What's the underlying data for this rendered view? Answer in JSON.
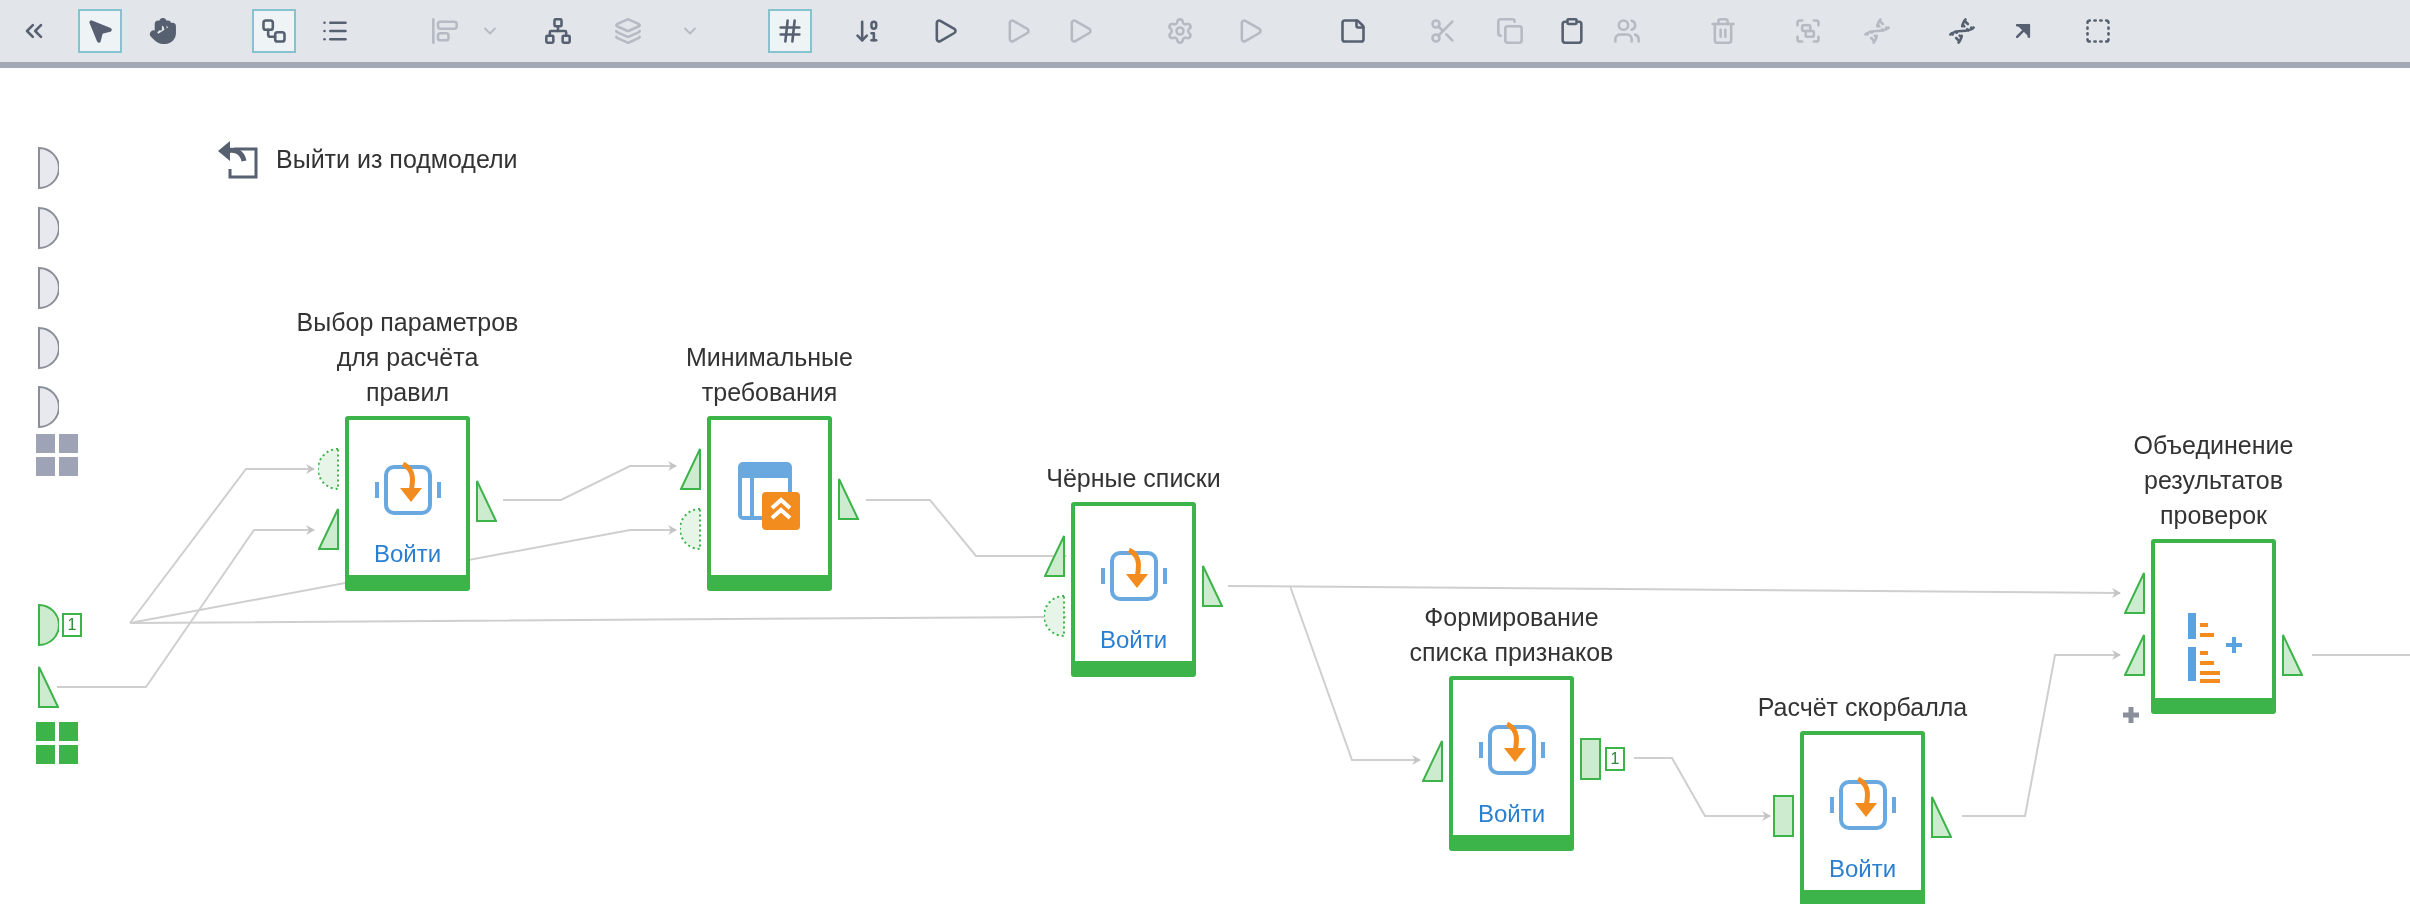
{
  "toolbar": {
    "tools": [
      {
        "kind": "collapse",
        "selected": false,
        "disabled": false
      },
      {
        "kind": "pointer",
        "selected": true,
        "disabled": false
      },
      {
        "kind": "hand",
        "selected": false,
        "disabled": false
      },
      {
        "kind": "diagram",
        "selected": true,
        "disabled": false
      },
      {
        "kind": "list",
        "selected": false,
        "disabled": false
      },
      {
        "kind": "align",
        "selected": false,
        "disabled": true
      },
      {
        "kind": "caret",
        "selected": false,
        "disabled": true
      },
      {
        "kind": "network",
        "selected": false,
        "disabled": false
      },
      {
        "kind": "layers",
        "selected": false,
        "disabled": true
      },
      {
        "kind": "caret",
        "selected": false,
        "disabled": true
      },
      {
        "kind": "hash",
        "selected": true,
        "disabled": false
      },
      {
        "kind": "numbers",
        "selected": false,
        "disabled": false
      },
      {
        "kind": "play",
        "selected": false,
        "disabled": false
      },
      {
        "kind": "play",
        "selected": false,
        "disabled": true
      },
      {
        "kind": "play",
        "selected": false,
        "disabled": true
      },
      {
        "kind": "gear",
        "selected": false,
        "disabled": true
      },
      {
        "kind": "play",
        "selected": false,
        "disabled": true
      },
      {
        "kind": "note",
        "selected": false,
        "disabled": false
      },
      {
        "kind": "cut",
        "selected": false,
        "disabled": true
      },
      {
        "kind": "copy",
        "selected": false,
        "disabled": true
      },
      {
        "kind": "paste",
        "selected": false,
        "disabled": false
      },
      {
        "kind": "people",
        "selected": false,
        "disabled": true
      },
      {
        "kind": "trash",
        "selected": false,
        "disabled": true
      },
      {
        "kind": "group",
        "selected": false,
        "disabled": true
      },
      {
        "kind": "dna",
        "selected": false,
        "disabled": true
      },
      {
        "kind": "dna",
        "selected": false,
        "disabled": false
      },
      {
        "kind": "arrow",
        "selected": false,
        "disabled": false
      },
      {
        "kind": "selection",
        "selected": false,
        "disabled": false
      }
    ]
  },
  "exit_link": {
    "label": "Выйти из подмодели"
  },
  "model_ports": [
    {
      "kind": "half",
      "active": false
    },
    {
      "kind": "half",
      "active": false
    },
    {
      "kind": "half",
      "active": false
    },
    {
      "kind": "half",
      "active": false
    },
    {
      "kind": "half",
      "active": false
    },
    {
      "kind": "grid",
      "active": false
    },
    {
      "kind": "half",
      "active": true,
      "badge": "1"
    },
    {
      "kind": "triangle",
      "active": true
    },
    {
      "kind": "grid",
      "active": true
    }
  ],
  "nodes": [
    {
      "kind": "enter",
      "label": "Выбор параметров\nдля расчёта\nправил",
      "action": "Войти",
      "inputs": [
        {
          "kind": "dotted"
        },
        {
          "kind": "triangle"
        }
      ],
      "outputs": [
        {
          "kind": "triangle"
        }
      ]
    },
    {
      "kind": "table",
      "label": "Минимальные\nтребования",
      "inputs": [
        {
          "kind": "triangle"
        },
        {
          "kind": "dotted"
        }
      ],
      "outputs": [
        {
          "kind": "triangle"
        }
      ]
    },
    {
      "kind": "enter",
      "label": "Чёрные списки",
      "action": "Войти",
      "inputs": [
        {
          "kind": "triangle"
        },
        {
          "kind": "dotted"
        }
      ],
      "outputs": [
        {
          "kind": "triangle"
        }
      ]
    },
    {
      "kind": "enter",
      "label": "Формирование\nсписка признаков",
      "action": "Войти",
      "inputs": [
        {
          "kind": "triangle"
        }
      ],
      "outputs": [
        {
          "kind": "rect",
          "badge": "1"
        }
      ]
    },
    {
      "kind": "enter",
      "label": "Расчёт скорбалла",
      "action": "Войти",
      "inputs": [
        {
          "kind": "rect"
        }
      ],
      "outputs": [
        {
          "kind": "triangle"
        }
      ]
    },
    {
      "kind": "merge",
      "label": "Объединение\nрезультатов\nпроверок",
      "inputs": [
        {
          "kind": "triangle"
        },
        {
          "kind": "triangle"
        }
      ],
      "outputs": [
        {
          "kind": "triangle"
        }
      ],
      "can_add_input": true
    }
  ]
}
